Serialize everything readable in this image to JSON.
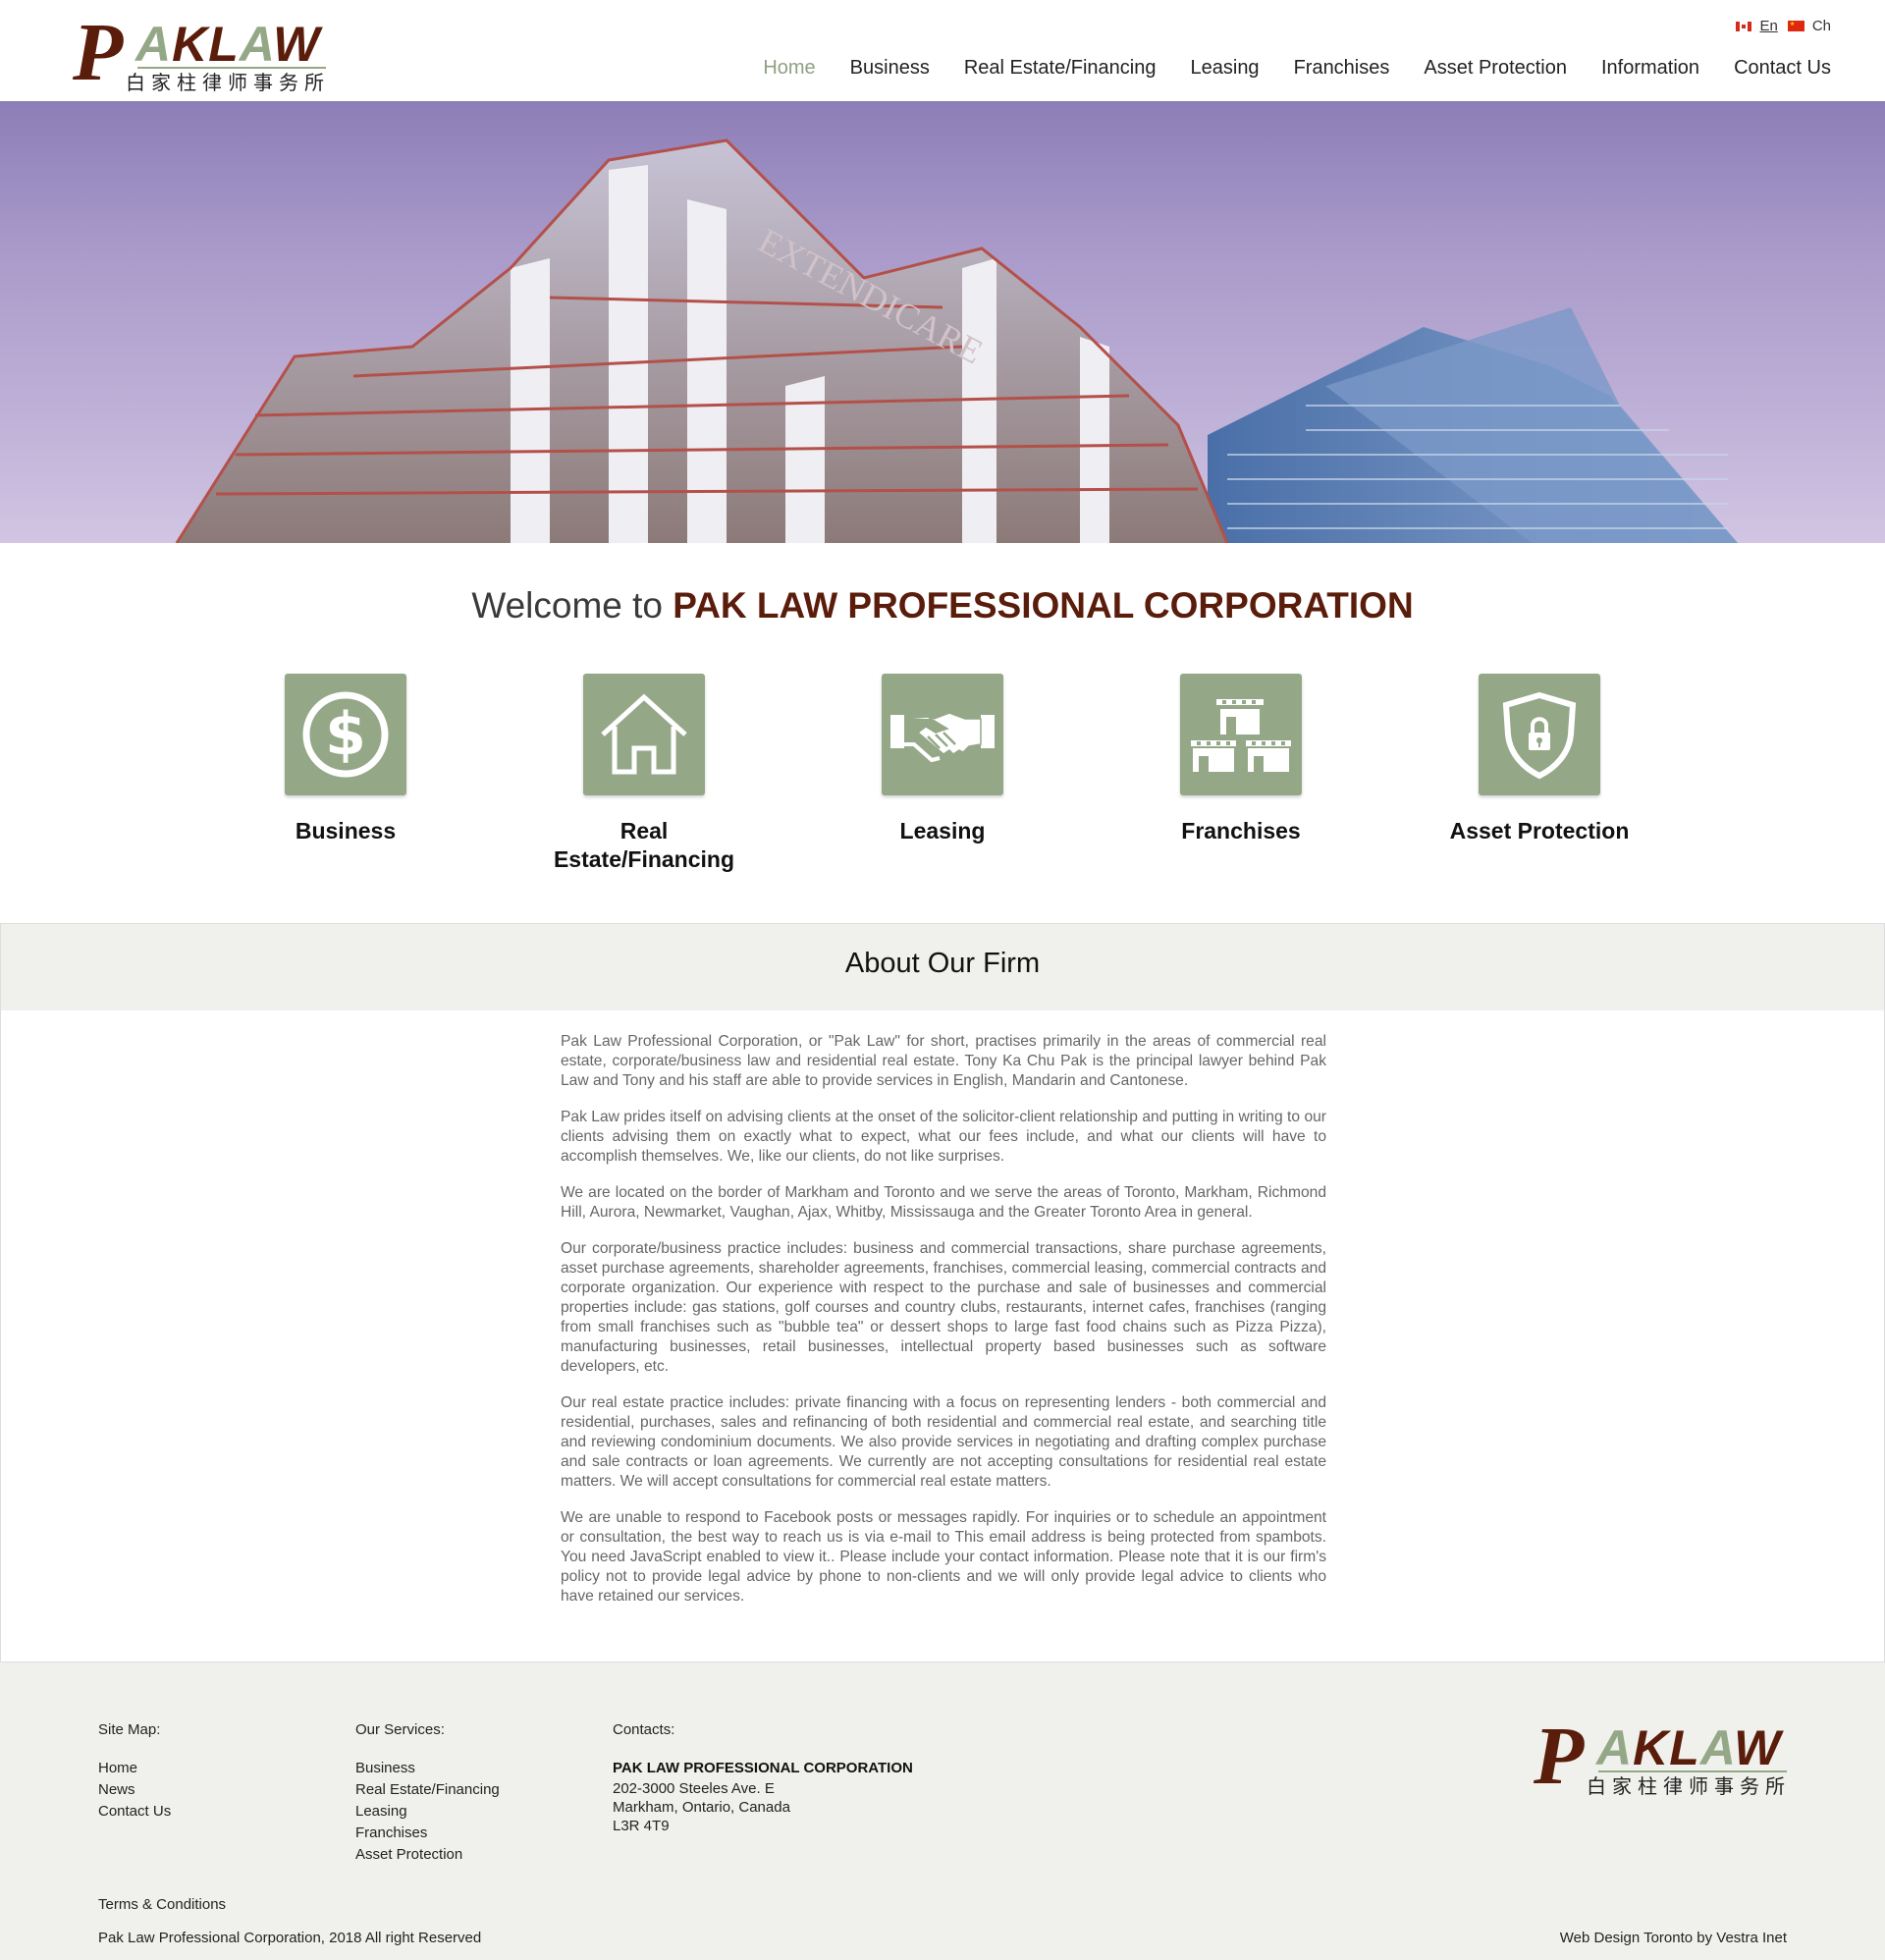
{
  "logo": {
    "p": "P",
    "aklaw_a": "A",
    "aklaw_k": "K",
    "aklaw_l": "L",
    "aklaw_a2": "A",
    "aklaw_w": "W",
    "chinese": "白家柱律师事务所"
  },
  "lang": {
    "en": "En",
    "ch": "Ch"
  },
  "nav": [
    "Home",
    "Business",
    "Real Estate/Financing",
    "Leasing",
    "Franchises",
    "Asset Protection",
    "Information",
    "Contact Us"
  ],
  "welcome": {
    "prefix": "Welcome to",
    "company": "PAK LAW PROFESSIONAL CORPORATION"
  },
  "services": [
    {
      "label": "Business",
      "icon": "dollar-icon"
    },
    {
      "label": "Real Estate/Financing",
      "icon": "house-icon"
    },
    {
      "label": "Leasing",
      "icon": "handshake-icon"
    },
    {
      "label": "Franchises",
      "icon": "storefronts-icon"
    },
    {
      "label": "Asset Protection",
      "icon": "shield-lock-icon"
    }
  ],
  "about": {
    "title": "About Our Firm",
    "paragraphs": [
      "Pak Law Professional Corporation, or \"Pak Law\" for short, practises primarily in the areas of commercial real estate, corporate/business law and residential real estate. Tony Ka Chu Pak is the principal lawyer behind Pak Law and Tony and his staff are able to provide services in English, Mandarin and Cantonese.",
      "Pak Law prides itself on advising clients at the onset of the solicitor-client relationship and putting in writing to our clients advising them on exactly what to expect, what our fees include, and what our clients will have to accomplish themselves. We, like our clients, do not like surprises.",
      "We are located on the border of Markham and Toronto and we serve the areas of Toronto, Markham, Richmond Hill, Aurora, Newmarket, Vaughan, Ajax, Whitby, Mississauga and the Greater Toronto Area in general.",
      "Our corporate/business practice includes: business and commercial transactions, share purchase agreements, asset purchase agreements, shareholder agreements, franchises, commercial leasing, commercial contracts and corporate organization. Our experience with respect to the purchase and sale of businesses and commercial properties include: gas stations, golf courses and country clubs, restaurants, internet cafes, franchises (ranging from small franchises such as \"bubble tea\" or dessert shops to large fast food chains such as Pizza Pizza), manufacturing businesses, retail businesses, intellectual property based businesses such as software developers, etc.",
      "Our real estate practice includes: private financing with a focus on representing lenders - both commercial and residential, purchases, sales and refinancing of both residential and commercial real estate, and searching title and reviewing condominium documents. We also provide services in negotiating and drafting complex purchase and sale contracts or loan agreements. We currently are not accepting consultations for residential real estate matters. We will accept consultations for commercial real estate matters.",
      "We are unable to respond to Facebook posts or messages rapidly. For inquiries or to schedule an appointment or consultation, the best way to reach us is via e-mail to This email address is being protected from spambots. You need JavaScript enabled to view it.. Please include your contact information. Please note that it is our firm's policy not to provide legal advice by phone to non-clients and we will only provide legal advice to clients who have retained our services."
    ]
  },
  "footer": {
    "sitemap_title": "Site Map:",
    "sitemap": [
      "Home",
      "News",
      "Contact Us"
    ],
    "services_title": "Our Services:",
    "services": [
      "Business",
      "Real Estate/Financing",
      "Leasing",
      "Franchises",
      "Asset Protection"
    ],
    "contacts_title": "Contacts:",
    "company": "PAK LAW PROFESSIONAL CORPORATION",
    "address": [
      "202-3000 Steeles Ave. E",
      "Markham, Ontario, Canada",
      "L3R 4T9"
    ],
    "terms": "Terms & Conditions",
    "copyright": "Pak Law Professional Corporation, 2018 All right Reserved",
    "credit": "Web Design Toronto by Vestra Inet"
  },
  "colors": {
    "brand_brown": "#5a1c0b",
    "brand_green": "#94a887",
    "footer_bg": "#f0f1ec"
  }
}
